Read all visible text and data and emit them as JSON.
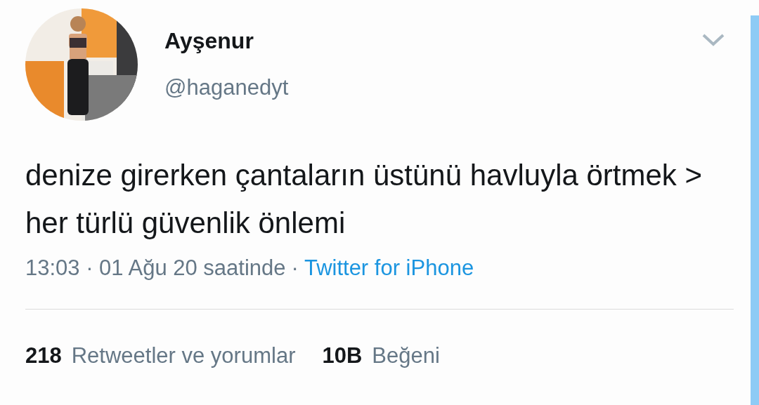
{
  "author": {
    "name": "Ayşenur",
    "handle": "@haganedyt"
  },
  "tweet": {
    "text": "denize girerken çantaların üstünü havluyla örtmek > her türlü güvenlik önlemi"
  },
  "meta": {
    "time": "13:03 · 01 Ağu 20 saatinde",
    "separator": "·",
    "source": "Twitter for iPhone"
  },
  "stats": [
    {
      "count": "218",
      "label": "Retweetler ve yorumlar"
    },
    {
      "count": "10B",
      "label": "Beğeni"
    }
  ]
}
